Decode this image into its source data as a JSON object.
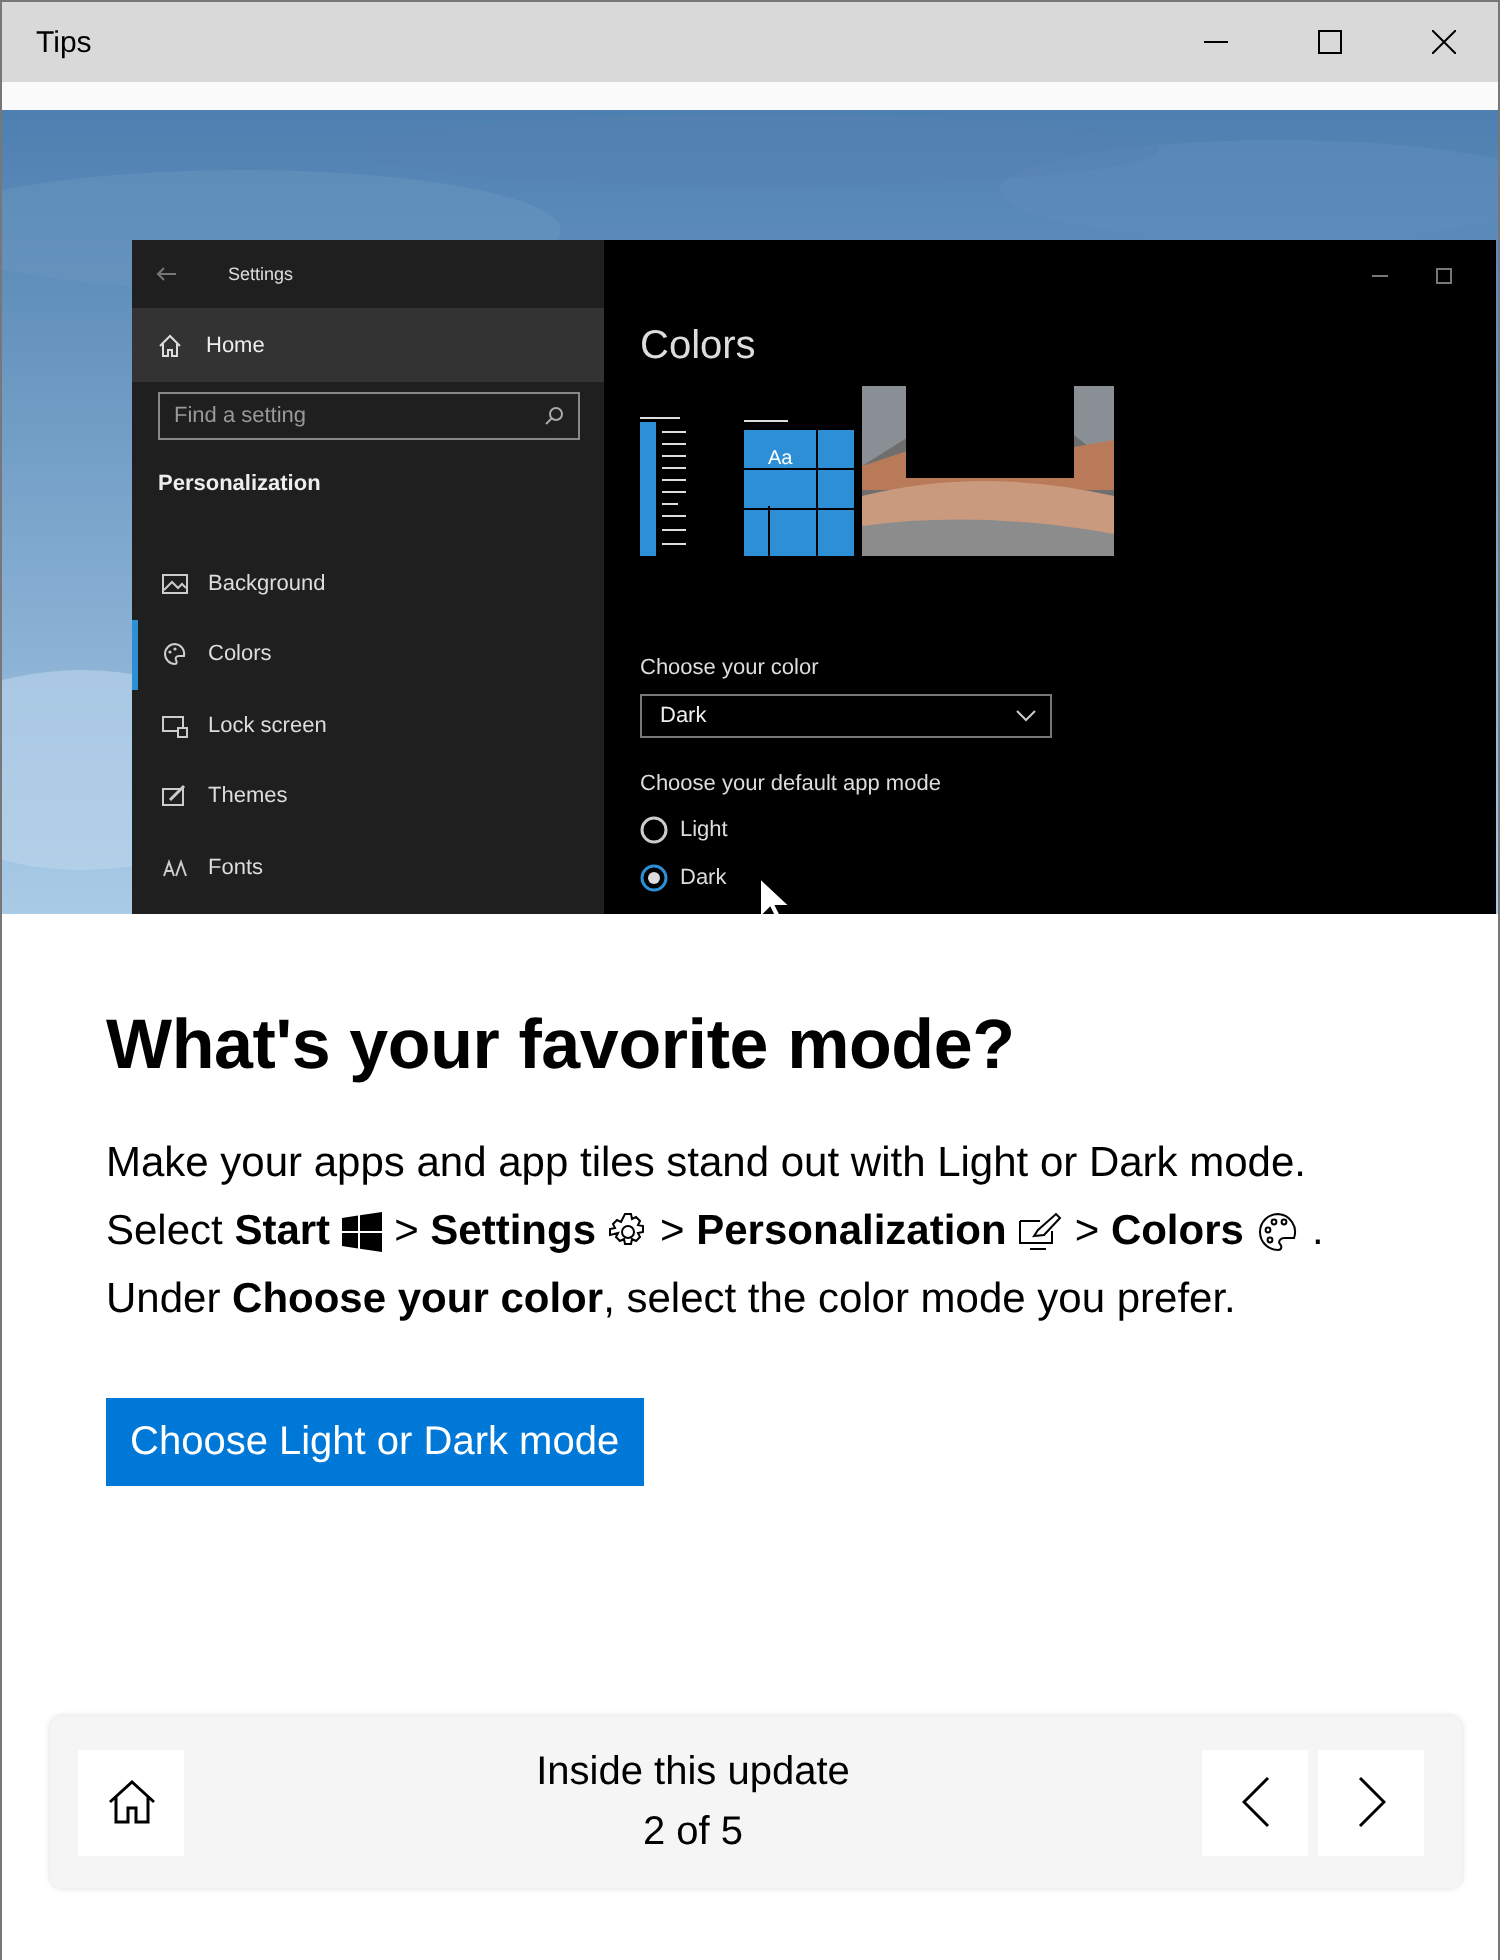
{
  "window": {
    "title": "Tips"
  },
  "settings_window": {
    "title": "Settings",
    "home": "Home",
    "search": {
      "placeholder": "Find a setting"
    },
    "section": "Personalization",
    "nav_items": [
      {
        "label": "Background",
        "selected": false
      },
      {
        "label": "Colors",
        "kind": "palette",
        "selected": true
      },
      {
        "label": "Lock screen",
        "kind": "lock",
        "selected": false
      },
      {
        "label": "Themes",
        "kind": "themes",
        "selected": false
      },
      {
        "label": "Fonts",
        "kind": "fonts",
        "selected": false
      }
    ],
    "page_title": "Colors",
    "tile_text": "Aa",
    "color_label": "Choose your color",
    "color_value": "Dark",
    "mode_label": "Choose your default app mode",
    "modes": [
      {
        "label": "Light",
        "selected": false
      },
      {
        "label": "Dark",
        "selected": true
      }
    ]
  },
  "heading": "What's your favorite mode?",
  "body": {
    "line_1": "Make your apps and app tiles stand out with Light or Dark mode.",
    "line_2": [
      {
        "text": "Select **Start**",
        "kind": "windows"
      },
      {
        "text": "> **Settings**",
        "kind": "gear"
      },
      {
        "text": "> **Personalization**",
        "kind": "personalization"
      },
      {
        "text": "> **Colors**",
        "kind": "palette"
      },
      {
        "text": "."
      }
    ],
    "line_3": "Under **Choose your color**, select the color mode you prefer."
  },
  "action_button": "Choose Light or Dark mode",
  "footer": {
    "title": "Inside this update",
    "position": "2 of 5"
  }
}
